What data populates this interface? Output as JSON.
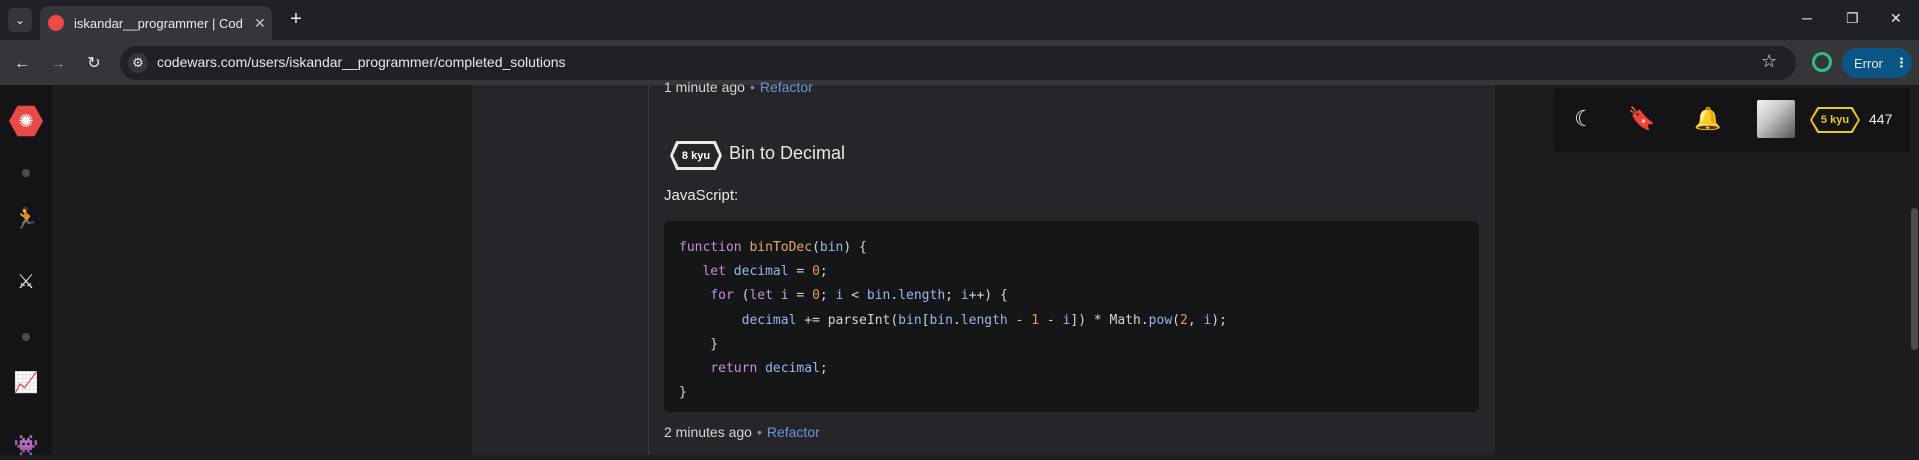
{
  "browser": {
    "tab_title": "iskandar__programmer | Codewars",
    "tab_close": "✕",
    "new_tab": "+",
    "url": "codewars.com/users/iskandar__programmer/completed_solutions",
    "error_label": "Error",
    "window_minimize": "─",
    "window_restore": "❐",
    "window_close": "✕"
  },
  "sidebar": {
    "logo": "codewars-logo-icon",
    "items": [
      {
        "icon": "practice-icon",
        "glyph": "🏃"
      },
      {
        "icon": "clans-icon",
        "glyph": "⚔"
      },
      {
        "icon": "leaderboards-icon",
        "glyph": "📈"
      },
      {
        "icon": "discord-icon",
        "glyph": "👾"
      }
    ]
  },
  "solutions": {
    "previous": {
      "time": "1 minute ago",
      "action": "Refactor"
    },
    "kata": {
      "rank": "8 kyu",
      "title": "Bin to Decimal",
      "language": "JavaScript:",
      "code_lines": [
        "function binToDec(bin) {",
        "   let decimal = 0;",
        "    for (let i = 0; i < bin.length; i++) {",
        "        decimal += parseInt(bin[bin.length - 1 - i]) * Math.pow(2, i);",
        "    }",
        "    return decimal;",
        "}"
      ],
      "time": "2 minutes ago",
      "action": "Refactor"
    }
  },
  "user_panel": {
    "rank": "5 kyu",
    "honor": "447",
    "rank_color": "#eec52a"
  },
  "colors": {
    "background": "#1d1d20",
    "panel": "#26262a",
    "accent_red": "#e84a4a",
    "link": "#6896d5"
  }
}
